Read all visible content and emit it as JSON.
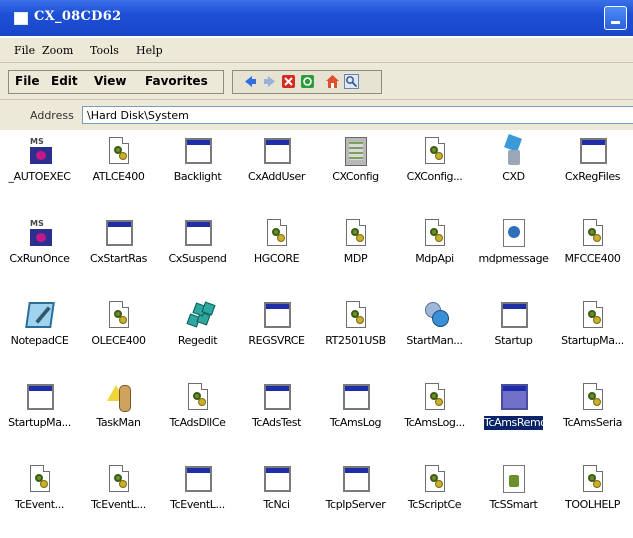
{
  "window": {
    "title": "CX_08CD62"
  },
  "menubar": {
    "file": "File",
    "zoom": "Zoom",
    "tools": "Tools",
    "help": "Help"
  },
  "explorer_menu": {
    "file": "File",
    "edit": "Edit",
    "view": "View",
    "favorites": "Favorites"
  },
  "address": {
    "label": "Address",
    "value": "\\Hard Disk\\System"
  },
  "files": [
    {
      "label": "_AUTOEXEC",
      "icon": "msdos-icon"
    },
    {
      "label": "ATLCE400",
      "icon": "gear-file-icon"
    },
    {
      "label": "Backlight",
      "icon": "application-icon"
    },
    {
      "label": "CxAddUser",
      "icon": "application-icon"
    },
    {
      "label": "CXConfig",
      "icon": "config-icon"
    },
    {
      "label": "CXConfig...",
      "icon": "gear-file-icon"
    },
    {
      "label": "CXD",
      "icon": "recycle-icon"
    },
    {
      "label": "CxRegFiles",
      "icon": "application-icon"
    },
    {
      "label": "CxRunOnce",
      "icon": "msdos-icon"
    },
    {
      "label": "CxStartRas",
      "icon": "application-icon"
    },
    {
      "label": "CxSuspend",
      "icon": "application-icon"
    },
    {
      "label": "HGCORE",
      "icon": "gear-file-icon"
    },
    {
      "label": "MDP",
      "icon": "gear-file-icon"
    },
    {
      "label": "MdpApi",
      "icon": "gear-file-icon"
    },
    {
      "label": "mdpmessage",
      "icon": "message-icon"
    },
    {
      "label": "MFCCE400",
      "icon": "gear-file-icon"
    },
    {
      "label": "NotepadCE",
      "icon": "notepad-icon"
    },
    {
      "label": "OLECE400",
      "icon": "gear-file-icon"
    },
    {
      "label": "Regedit",
      "icon": "regedit-icon"
    },
    {
      "label": "REGSVRCE",
      "icon": "application-icon"
    },
    {
      "label": "RT2501USB",
      "icon": "gear-file-icon"
    },
    {
      "label": "StartMan...",
      "icon": "startman-icon"
    },
    {
      "label": "Startup",
      "icon": "application-icon"
    },
    {
      "label": "StartupMa...",
      "icon": "gear-file-icon"
    },
    {
      "label": "StartupMa...",
      "icon": "application-icon"
    },
    {
      "label": "TaskMan",
      "icon": "taskman-icon"
    },
    {
      "label": "TcAdsDllCe",
      "icon": "gear-file-icon"
    },
    {
      "label": "TcAdsTest",
      "icon": "application-icon"
    },
    {
      "label": "TcAmsLog",
      "icon": "application-icon"
    },
    {
      "label": "TcAmsLog...",
      "icon": "gear-file-icon"
    },
    {
      "label": "TcAmsRemoteMgr",
      "icon": "application-icon",
      "selected": true
    },
    {
      "label": "TcAmsSeria",
      "icon": "gear-file-icon"
    },
    {
      "label": "TcEvent...",
      "icon": "gear-file-icon"
    },
    {
      "label": "TcEventL...",
      "icon": "gear-file-icon"
    },
    {
      "label": "TcEventL...",
      "icon": "application-icon"
    },
    {
      "label": "TcNci",
      "icon": "application-icon"
    },
    {
      "label": "TcpIpServer",
      "icon": "application-icon"
    },
    {
      "label": "TcScriptCe",
      "icon": "gear-file-icon"
    },
    {
      "label": "TcSSmart",
      "icon": "smart-icon"
    },
    {
      "label": "TOOLHELP",
      "icon": "gear-file-icon"
    }
  ]
}
